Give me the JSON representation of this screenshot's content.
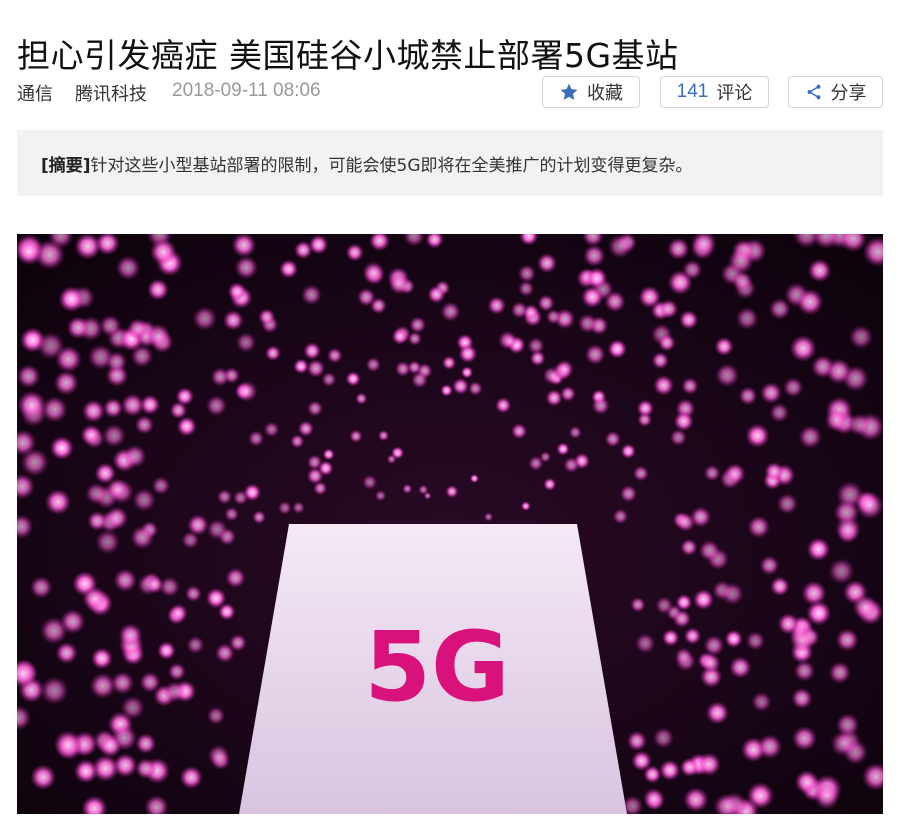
{
  "article": {
    "title": "担心引发癌症 美国硅谷小城禁止部署5G基站",
    "source": "通信",
    "category": "腾讯科技",
    "time": "2018-09-11 08:06"
  },
  "actions": {
    "favorite_label": "收藏",
    "comment_count": "141",
    "comment_label": "评论",
    "share_label": "分享"
  },
  "summary": {
    "tag": "[摘要]",
    "text": "针对这些小型基站部署的限制，可能会使5G即将在全美推广的计划变得更复杂。"
  },
  "image": {
    "sign_text": "5G"
  },
  "colors": {
    "accent_blue": "#3a6fb8",
    "magenta": "#d8127a",
    "light_pink": "#ff7ee0"
  }
}
